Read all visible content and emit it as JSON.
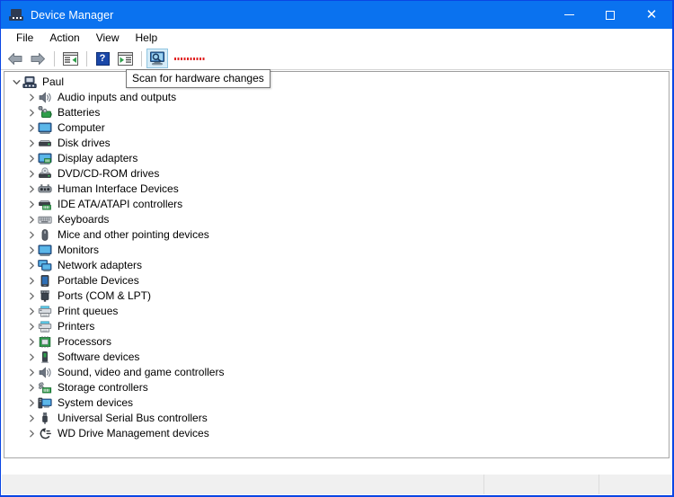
{
  "window": {
    "title": "Device Manager",
    "title_icon": "device-manager-icon",
    "accent_color": "#0a72ef",
    "controls": {
      "minimize_label": "—",
      "minimize_name": "minimize-button",
      "maximize_label": "□",
      "maximize_name": "maximize-button",
      "close_label": "✕",
      "close_name": "close-button"
    }
  },
  "menubar": {
    "items": [
      {
        "label": "File",
        "name": "menu-file"
      },
      {
        "label": "Action",
        "name": "menu-action"
      },
      {
        "label": "View",
        "name": "menu-view"
      },
      {
        "label": "Help",
        "name": "menu-help"
      }
    ]
  },
  "toolbar": {
    "items": [
      {
        "name": "back-button",
        "icon": "back-arrow-icon",
        "active": false
      },
      {
        "name": "forward-button",
        "icon": "forward-arrow-icon",
        "active": false
      },
      {
        "name": "show-hide-console-tree-button",
        "icon": "console-tree-icon",
        "active": false
      },
      {
        "name": "help-button",
        "icon": "question-mark-icon",
        "active": false
      },
      {
        "name": "properties-button",
        "icon": "properties-icon",
        "active": false
      },
      {
        "name": "scan-for-hardware-changes-button",
        "icon": "monitor-magnifier-icon",
        "active": true
      }
    ],
    "red_marker_name": "red-dashed-marker"
  },
  "tooltip": {
    "text": "Scan for hardware changes",
    "visible": true
  },
  "tree": {
    "root": {
      "label": "Paul",
      "icon": "computer-node-icon",
      "expanded": true,
      "chevron": "chevron-down"
    },
    "nodes": [
      {
        "label": "Audio inputs and outputs",
        "icon": "speaker-icon"
      },
      {
        "label": "Batteries",
        "icon": "battery-icon"
      },
      {
        "label": "Computer",
        "icon": "monitor-icon"
      },
      {
        "label": "Disk drives",
        "icon": "disk-drive-icon"
      },
      {
        "label": "Display adapters",
        "icon": "display-adapter-icon"
      },
      {
        "label": "DVD/CD-ROM drives",
        "icon": "optical-drive-icon"
      },
      {
        "label": "Human Interface Devices",
        "icon": "hid-icon"
      },
      {
        "label": "IDE ATA/ATAPI controllers",
        "icon": "ide-controller-icon"
      },
      {
        "label": "Keyboards",
        "icon": "keyboard-icon"
      },
      {
        "label": "Mice and other pointing devices",
        "icon": "mouse-icon"
      },
      {
        "label": "Monitors",
        "icon": "monitor-icon"
      },
      {
        "label": "Network adapters",
        "icon": "network-adapter-icon"
      },
      {
        "label": "Portable Devices",
        "icon": "portable-device-icon"
      },
      {
        "label": "Ports (COM & LPT)",
        "icon": "port-icon"
      },
      {
        "label": "Print queues",
        "icon": "printer-icon"
      },
      {
        "label": "Printers",
        "icon": "printer-icon"
      },
      {
        "label": "Processors",
        "icon": "processor-icon"
      },
      {
        "label": "Software devices",
        "icon": "software-device-icon"
      },
      {
        "label": "Sound, video and game controllers",
        "icon": "speaker-icon"
      },
      {
        "label": "Storage controllers",
        "icon": "storage-controller-icon"
      },
      {
        "label": "System devices",
        "icon": "system-device-icon"
      },
      {
        "label": "Universal Serial Bus controllers",
        "icon": "usb-icon"
      },
      {
        "label": "WD Drive Management devices",
        "icon": "wd-drive-icon"
      }
    ],
    "child_chevron": "chevron-right"
  },
  "statusbar": {
    "panes": [
      {
        "name": "status-pane-main",
        "text": ""
      },
      {
        "name": "status-pane-secondary",
        "text": ""
      },
      {
        "name": "status-pane-tertiary",
        "text": ""
      }
    ]
  }
}
